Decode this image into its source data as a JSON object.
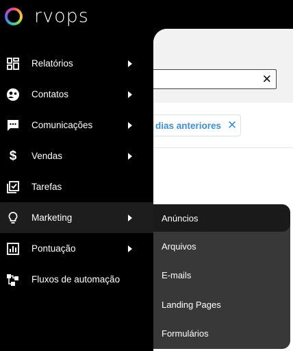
{
  "brand": {
    "name": "rvops"
  },
  "background": {
    "filter_chip": {
      "label": "dias anteriores",
      "close_glyph": "✕"
    },
    "search": {
      "clear_glyph": "✕"
    }
  },
  "sidebar": {
    "items": [
      {
        "label": "Relatórios",
        "icon": "reports-grid-icon",
        "has_submenu": true
      },
      {
        "label": "Contatos",
        "icon": "contacts-icon",
        "has_submenu": true
      },
      {
        "label": "Comunicações",
        "icon": "chat-icon",
        "has_submenu": true
      },
      {
        "label": "Vendas",
        "icon": "dollar-icon",
        "has_submenu": true
      },
      {
        "label": "Tarefas",
        "icon": "tasks-check-icon",
        "has_submenu": false
      },
      {
        "label": "Marketing",
        "icon": "lightbulb-icon",
        "has_submenu": true,
        "active": true
      },
      {
        "label": "Pontuação",
        "icon": "bar-chart-icon",
        "has_submenu": true
      },
      {
        "label": "Fluxos de automação",
        "icon": "automation-flow-icon",
        "has_submenu": false
      }
    ]
  },
  "submenu": {
    "parent": "Marketing",
    "items": [
      {
        "label": "Anúncios",
        "active": true
      },
      {
        "label": "Arquivos"
      },
      {
        "label": "E-mails"
      },
      {
        "label": "Landing Pages"
      },
      {
        "label": "Formulários"
      }
    ]
  },
  "colors": {
    "sidebar_bg": "#000000",
    "active_item_bg": "#1d1d1d",
    "submenu_bg": "#383838",
    "submenu_active_bg": "#1a1a1a",
    "link_blue": "#3d8fd6"
  }
}
